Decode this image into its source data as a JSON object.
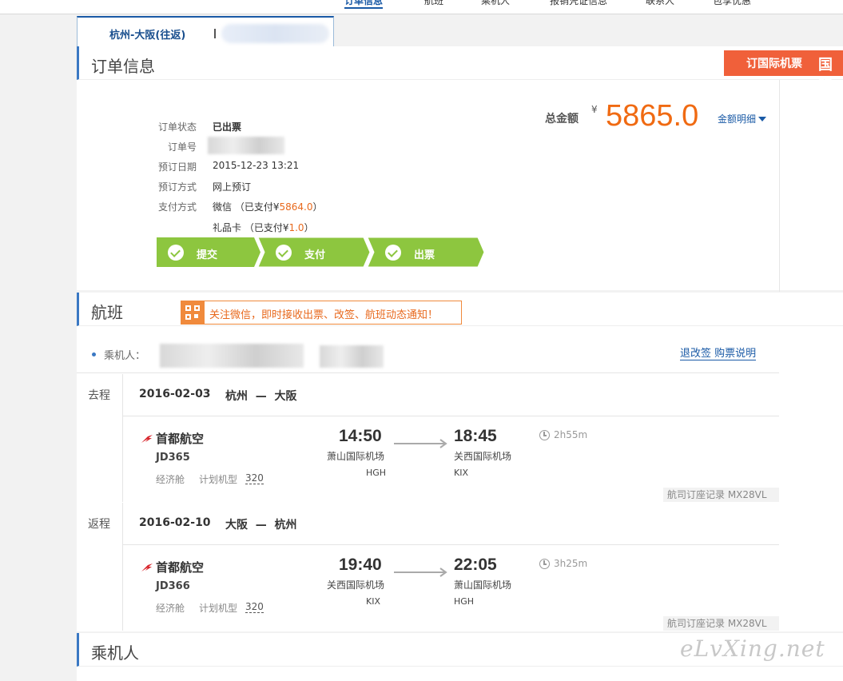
{
  "top_nav": {
    "items": [
      {
        "label": "订单信息",
        "active": true
      },
      {
        "label": "航班"
      },
      {
        "label": "乘机人"
      },
      {
        "label": "报销凭证信息"
      },
      {
        "label": "联系人"
      },
      {
        "label": "包享优惠"
      }
    ]
  },
  "route_tab": {
    "label": "杭州-大阪(往返)"
  },
  "order": {
    "section_title": "订单信息",
    "intl_banner": {
      "text": "订国际机票",
      "text2": "国际"
    },
    "fields": {
      "status_label": "订单状态",
      "status_value": "已出票",
      "order_no_label": "订单号",
      "book_date_label": "预订日期",
      "book_date_value": "2015-12-23 13:21",
      "book_method_label": "预订方式",
      "book_method_value": "网上预订",
      "pay_method_label": "支付方式",
      "pay1_method": "微信",
      "pay1_prefix": "（已支付¥",
      "pay1_amount": "5864.0",
      "pay1_suffix": "）",
      "pay2_method": "礼品卡",
      "pay2_prefix": "（已支付¥",
      "pay2_amount": "1.0",
      "pay2_suffix": "）"
    },
    "total_label": "总金额",
    "currency": "¥",
    "total_amount": "5865.0",
    "detail_link": "金额明细",
    "progress_steps": [
      {
        "label": "提交",
        "done": true
      },
      {
        "label": "支付",
        "done": true
      },
      {
        "label": "出票",
        "done": true
      }
    ],
    "colors": {
      "accent": "#1a5aa6",
      "amount": "#f06a12",
      "progress": "#8dc63f"
    }
  },
  "flights": {
    "section_title": "航班",
    "wechat_notice": "关注微信，即时接收出票、改签、航班动态通知！",
    "passenger_label": "乘机人：",
    "rules_link": "退改签 购票说明",
    "legs": [
      {
        "direction": "去程",
        "date": "2016-02-03",
        "from_city": "杭州",
        "dash": "—",
        "to_city": "大阪",
        "airline": "首都航空",
        "flight_no": "JD365",
        "cabin": "经济舱",
        "plane_label": "计划机型",
        "plane": "320",
        "dep_time": "14:50",
        "dep_airport": "萧山国际机场",
        "dep_code": "HGH",
        "arr_time": "18:45",
        "arr_airport": "关西国际机场",
        "arr_code": "KIX",
        "duration": "2h55m",
        "pnr": "航司订座记录 MX28VL"
      },
      {
        "direction": "返程",
        "date": "2016-02-10",
        "from_city": "大阪",
        "dash": "—",
        "to_city": "杭州",
        "airline": "首都航空",
        "flight_no": "JD366",
        "cabin": "经济舱",
        "plane_label": "计划机型",
        "plane": "320",
        "dep_time": "19:40",
        "dep_airport": "关西国际机场",
        "dep_code": "KIX",
        "arr_time": "22:05",
        "arr_airport": "萧山国际机场",
        "arr_code": "HGH",
        "duration": "3h25m",
        "pnr": "航司订座记录 MX28VL"
      }
    ]
  },
  "passengers": {
    "section_title": "乘机人"
  },
  "watermark": "eLvXing.net"
}
